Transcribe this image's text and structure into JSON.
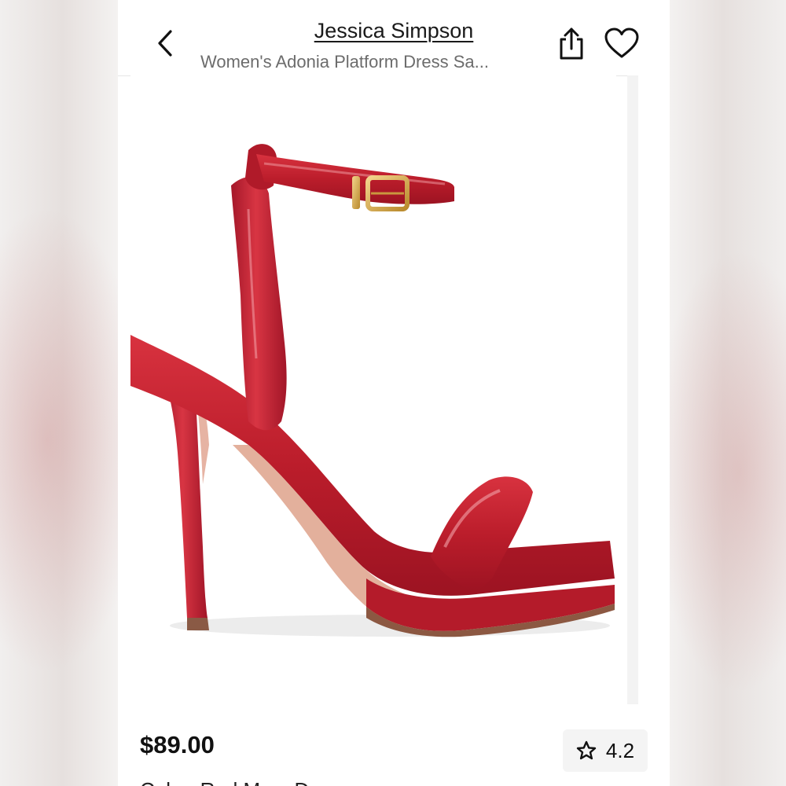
{
  "header": {
    "brand": "Jessica Simpson",
    "product_title": "Women's Adonia Platform Dress Sa..."
  },
  "product": {
    "price": "$89.00",
    "rating": "4.2",
    "color_line": "Color: Red Mary D..."
  },
  "icons": {
    "back": "chevron-left-icon",
    "share": "share-icon",
    "favorite": "heart-icon",
    "rating": "star-icon"
  },
  "colors": {
    "shoe_red": "#c0202e",
    "buckle_gold": "#d9a74a",
    "text_dark": "#111111",
    "text_muted": "#6c6c6c"
  }
}
